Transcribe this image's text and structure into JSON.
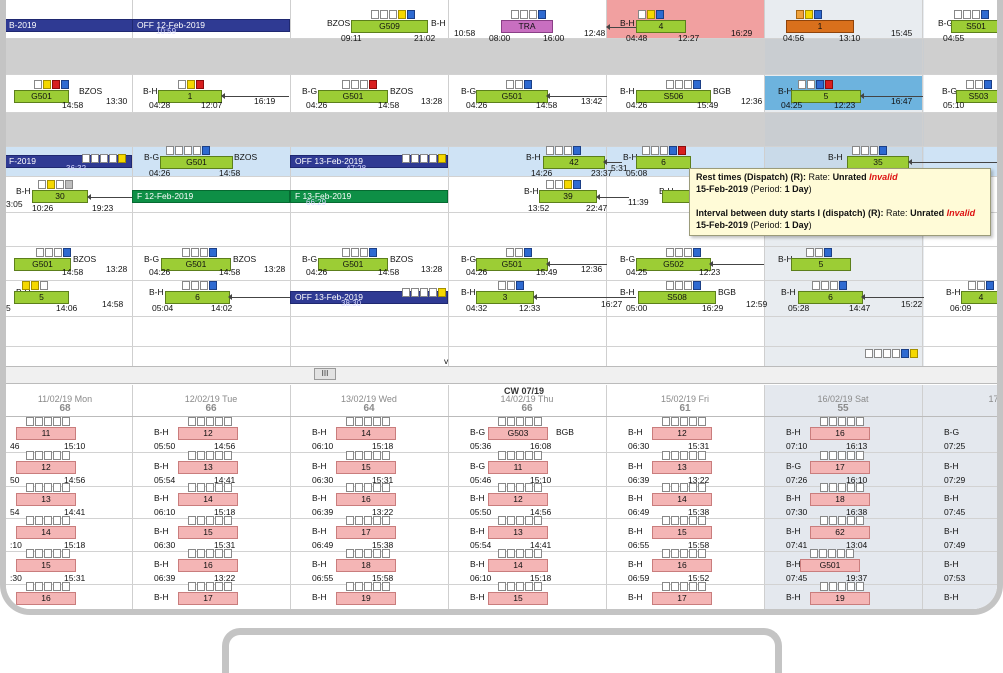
{
  "ribbon_top": {
    "bars": [
      {
        "label": "OFF 12-Feb-2019",
        "time": "10:59"
      },
      {
        "label": "G509"
      },
      {
        "label": "TRA"
      },
      {
        "label": "4"
      },
      {
        "label": "1"
      },
      {
        "label": "S501"
      }
    ],
    "labels": [
      "B-G",
      "BZOS",
      "B-H",
      "B-H",
      "B-G"
    ],
    "times": [
      "09:11",
      "21:02",
      "10:58",
      "08:00",
      "16:00",
      "12:48",
      "04:48",
      "12:27",
      "16:29",
      "04:56",
      "13:10",
      "15:45",
      "04:55"
    ],
    "cut_label": "B-2019"
  },
  "rows": [
    {
      "bars": [
        "G501",
        "1",
        "G501",
        "G501",
        "S506",
        "5",
        "S503"
      ],
      "labels": [
        "B-G",
        "B-H",
        "B-G",
        "B-G",
        "B-H",
        "BZOS",
        "BZOS",
        "BGB",
        "B-H",
        "B-G"
      ],
      "times": [
        "14:58",
        "13:30",
        "04:28",
        "12:07",
        "16:19",
        "04:26",
        "14:58",
        "13:28",
        "04:26",
        "14:58",
        "13:42",
        "04:26",
        "15:49",
        "12:36",
        "04:25",
        "12:23",
        "16:47",
        "05:10"
      ]
    },
    {
      "bars": [
        "G501",
        "42",
        "6",
        "35"
      ],
      "off": [
        {
          "label": "F-2019",
          "time": "36:32"
        },
        {
          "label": "OFF 13-Feb-2019",
          "time": "47:28"
        }
      ],
      "labels": [
        "B-G",
        "BZOS",
        "B-H",
        "B-H",
        "B-H"
      ],
      "times": [
        "04:26",
        "14:58",
        "14:26",
        "23:37",
        "5:31",
        "05:08",
        "12:20"
      ]
    },
    {
      "bars": [
        "30",
        "39"
      ],
      "off": [
        {
          "label": "F 12-Feb-2019"
        },
        {
          "label": "F 13-Feb-2019",
          "time": "66:29"
        }
      ],
      "labels": [
        "B-H",
        "B-H",
        "B-H"
      ],
      "times": [
        "3:05",
        "10:26",
        "19:23",
        "13:52",
        "22:47",
        "11:39"
      ]
    },
    {
      "bars": [
        "G501",
        "G501",
        "G501",
        "G501",
        "G502",
        "5"
      ],
      "labels": [
        "B-G",
        "B-G",
        "B-G",
        "B-G",
        "B-G",
        "B-H",
        "BZOS",
        "BZOS",
        "BZOS"
      ],
      "times": [
        "14:58",
        "13:28",
        "04:26",
        "14:58",
        "13:28",
        "04:26",
        "14:58",
        "13:28",
        "04:26",
        "15:49",
        "12:36",
        "04:25",
        "12:23"
      ]
    },
    {
      "bars": [
        "5",
        "6",
        "3",
        "S508",
        "6",
        "4"
      ],
      "off": [
        {
          "label": "OFF 13-Feb-2019",
          "time": "38:30"
        }
      ],
      "labels": [
        "B-H",
        "B-H",
        "B-H",
        "B-H",
        "B-H",
        "B-H",
        "BGB"
      ],
      "times": [
        "5",
        "14:06",
        "14:58",
        "05:04",
        "14:02",
        "04:32",
        "12:33",
        "16:27",
        "05:00",
        "16:29",
        "12:59",
        "05:28",
        "14:47",
        "15:22",
        "06:09"
      ]
    }
  ],
  "tooltip": {
    "line1_label": "Rest times (Dispatch) (R):",
    "line1_rate": "Rate:",
    "line1_val": "Unrated",
    "line1_inv": "Invalid",
    "line2_date": "15-Feb-2019",
    "line2_period": "(Period:",
    "line2_period_val": "1 Day",
    "line2_close": ")",
    "line3_label": "Interval between duty starts I (dispatch) (R):",
    "line3_rate": "Rate:",
    "line3_val": "Unrated",
    "line3_inv": "Invalid",
    "line4_date": "15-Feb-2019",
    "line4_period": "(Period:",
    "line4_period_val": "1 Day",
    "line4_close": ")"
  },
  "splitter": {
    "thumb": "III",
    "arrow": "v"
  },
  "week": {
    "cw": "CW 07/19",
    "days": [
      {
        "label": "11/02/19 Mon",
        "count": "68"
      },
      {
        "label": "12/02/19 Tue",
        "count": "66"
      },
      {
        "label": "13/02/19 Wed",
        "count": "64"
      },
      {
        "label": "14/02/19 Thu",
        "count": "66"
      },
      {
        "label": "15/02/19 Fri",
        "count": "61"
      },
      {
        "label": "16/02/19 Sat",
        "count": "55"
      },
      {
        "label": "17/02/",
        "count": "5"
      }
    ],
    "rows": [
      [
        {
          "lbl": "",
          "bar": "11",
          "s": "",
          "e": "15:10",
          "sl": "46"
        },
        {
          "lbl": "B-H",
          "bar": "12",
          "s": "05:50",
          "e": "14:56"
        },
        {
          "lbl": "B-H",
          "bar": "14",
          "s": "06:10",
          "e": "15:18"
        },
        {
          "lbl": "B-G",
          "bar": "G503",
          "s": "05:36",
          "e": "16:08",
          "tag": "BGB"
        },
        {
          "lbl": "B-H",
          "bar": "12",
          "s": "06:30",
          "e": "15:31"
        },
        {
          "lbl": "B-H",
          "bar": "16",
          "s": "07:10",
          "e": "16:13"
        },
        {
          "lbl": "B-G",
          "bar": "",
          "s": "07:25",
          "e": ""
        }
      ],
      [
        {
          "lbl": "",
          "bar": "12",
          "s": "",
          "e": "14:56",
          "sl": "50"
        },
        {
          "lbl": "B-H",
          "bar": "13",
          "s": "05:54",
          "e": "14:41"
        },
        {
          "lbl": "B-H",
          "bar": "15",
          "s": "06:30",
          "e": "15:31"
        },
        {
          "lbl": "B-G",
          "bar": "11",
          "s": "05:46",
          "e": "15:10"
        },
        {
          "lbl": "B-H",
          "bar": "13",
          "s": "06:39",
          "e": "13:22"
        },
        {
          "lbl": "B-G",
          "bar": "17",
          "s": "07:26",
          "e": "16:10"
        },
        {
          "lbl": "B-H",
          "bar": "",
          "s": "07:29",
          "e": ""
        }
      ],
      [
        {
          "lbl": "",
          "bar": "13",
          "s": "",
          "e": "14:41",
          "sl": "54"
        },
        {
          "lbl": "B-H",
          "bar": "14",
          "s": "06:10",
          "e": "15:18"
        },
        {
          "lbl": "B-H",
          "bar": "16",
          "s": "06:39",
          "e": "13:22"
        },
        {
          "lbl": "B-H",
          "bar": "12",
          "s": "05:50",
          "e": "14:56"
        },
        {
          "lbl": "B-H",
          "bar": "14",
          "s": "06:49",
          "e": "15:38"
        },
        {
          "lbl": "B-H",
          "bar": "18",
          "s": "07:30",
          "e": "16:38"
        },
        {
          "lbl": "B-H",
          "bar": "",
          "s": "07:45",
          "e": ""
        }
      ],
      [
        {
          "lbl": "",
          "bar": "14",
          "s": "",
          "e": "15:18",
          "sl": ":10"
        },
        {
          "lbl": "B-H",
          "bar": "15",
          "s": "06:30",
          "e": "15:31"
        },
        {
          "lbl": "B-H",
          "bar": "17",
          "s": "06:49",
          "e": "15:38"
        },
        {
          "lbl": "B-H",
          "bar": "13",
          "s": "05:54",
          "e": "14:41"
        },
        {
          "lbl": "B-H",
          "bar": "15",
          "s": "06:55",
          "e": "15:58"
        },
        {
          "lbl": "B-H",
          "bar": "62",
          "s": "07:41",
          "e": "13:04"
        },
        {
          "lbl": "B-H",
          "bar": "",
          "s": "07:49",
          "e": ""
        }
      ],
      [
        {
          "lbl": "",
          "bar": "15",
          "s": "",
          "e": "15:31",
          "sl": ":30"
        },
        {
          "lbl": "B-H",
          "bar": "16",
          "s": "06:39",
          "e": "13:22"
        },
        {
          "lbl": "B-H",
          "bar": "18",
          "s": "06:55",
          "e": "15:58"
        },
        {
          "lbl": "B-H",
          "bar": "14",
          "s": "06:10",
          "e": "15:18"
        },
        {
          "lbl": "B-H",
          "bar": "16",
          "s": "06:59",
          "e": "15:52"
        },
        {
          "lbl": "B-H",
          "bar": "G501",
          "s": "07:45",
          "e": "19:37"
        },
        {
          "lbl": "B-H",
          "bar": "",
          "s": "07:53",
          "e": ""
        }
      ],
      [
        {
          "lbl": "",
          "bar": "16",
          "s": "",
          "e": "",
          "sl": ""
        },
        {
          "lbl": "B-H",
          "bar": "17",
          "s": "",
          "e": ""
        },
        {
          "lbl": "B-H",
          "bar": "19",
          "s": "",
          "e": ""
        },
        {
          "lbl": "B-H",
          "bar": "15",
          "s": "",
          "e": ""
        },
        {
          "lbl": "B-H",
          "bar": "17",
          "s": "",
          "e": ""
        },
        {
          "lbl": "B-H",
          "bar": "19",
          "s": "",
          "e": ""
        },
        {
          "lbl": "B-H",
          "bar": "",
          "s": "",
          "e": ""
        }
      ]
    ]
  },
  "colors": {
    "green": "#9ccd35",
    "pink": "#f4b5b5",
    "offblue": "#2f3a93",
    "offgreen": "#0e8f46",
    "tooltip_bg": "#fffbd7",
    "weekend": "#e4e8ee"
  }
}
